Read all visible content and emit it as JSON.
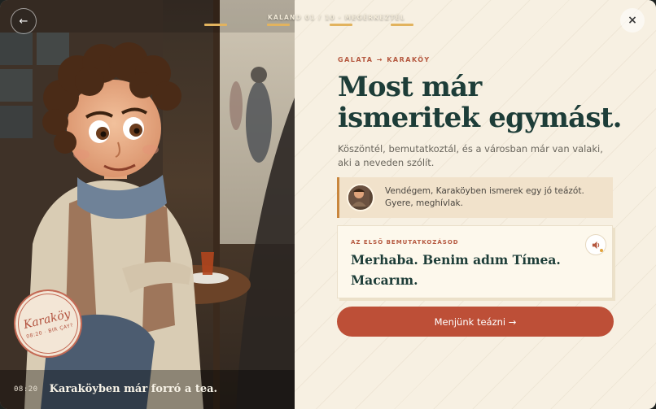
{
  "topbar": {
    "back_icon": "←",
    "close_icon": "×",
    "progress_label": "KALAND 01 / 10 · MEGÉRKEZTÉL",
    "progress_segments": 4,
    "progress_color": "#e2b35e"
  },
  "scene": {
    "time": "08:20",
    "caption": "Karaköyben már forró a tea.",
    "stamp": {
      "name": "Karaköy",
      "subtitle": "08:20 · BIR ÇAY?"
    }
  },
  "panel": {
    "route": "GALATA → KARAKÖY",
    "headline": "Most már ismeritek egymást.",
    "intro": "Köszöntél, bemutatkoztál, és a városban már van valaki, aki a neveden szólít.",
    "quote": "Vendégem, Karaköyben ismerek egy jó teázót. Gyere, meghívlak.",
    "card": {
      "label": "AZ ELSŐ BEMUTATKOZÁSOD",
      "phrase": "Merhaba. Benim adım Tímea. Macarım.",
      "speaker_icon": "speaker-icon"
    },
    "cta": "Menjünk teázni →"
  },
  "colors": {
    "accent": "#bd4f37",
    "heading": "#1d3d38",
    "panel_bg": "#f7f0e2",
    "quote_border": "#c9863d"
  }
}
